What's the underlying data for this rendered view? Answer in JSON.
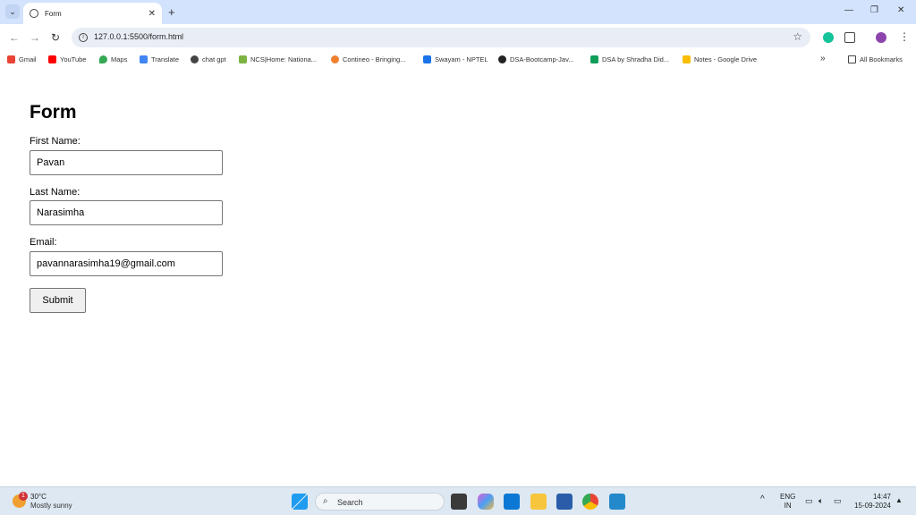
{
  "browser": {
    "tab_title": "Form",
    "url": "127.0.0.1:5500/form.html",
    "bookmarks": [
      {
        "label": "Gmail",
        "color": "#ea4335"
      },
      {
        "label": "YouTube",
        "color": "#ff0000"
      },
      {
        "label": "Maps",
        "color": "#34a853"
      },
      {
        "label": "Translate",
        "color": "#4285f4"
      },
      {
        "label": "chat gpt",
        "color": "#444444"
      },
      {
        "label": "NCS|Home: Nationa...",
        "color": "#7cb342"
      },
      {
        "label": "Contineo - Bringing...",
        "color": "#f08030"
      },
      {
        "label": "Swayam - NPTEL",
        "color": "#1a73e8"
      },
      {
        "label": "DSA-Bootcamp-Jav...",
        "color": "#222222"
      },
      {
        "label": "DSA by Shradha Did...",
        "color": "#0f9d58"
      },
      {
        "label": "Notes - Google Drive",
        "color": "#fbbc04"
      }
    ],
    "all_bookmarks": "All Bookmarks"
  },
  "page": {
    "title": "Form",
    "first_name_label": "First Name:",
    "first_name_value": "Pavan",
    "last_name_label": "Last Name:",
    "last_name_value": "Narasimha",
    "email_label": "Email:",
    "email_value": "pavannarasimha19@gmail.com",
    "submit_label": "Submit"
  },
  "taskbar": {
    "weather_temp": "30°C",
    "weather_cond": "Mostly sunny",
    "weather_badge": "1",
    "search_placeholder": "Search",
    "lang_1": "ENG",
    "lang_2": "IN",
    "time": "14:47",
    "date": "15-09-2024"
  }
}
